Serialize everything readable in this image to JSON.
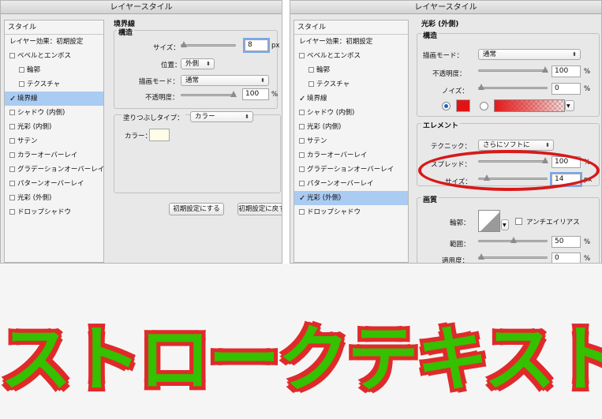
{
  "left_dialog": {
    "title": "レイヤースタイル",
    "sidebar_header": "スタイル",
    "sidebar_items": [
      {
        "label": "レイヤー効果：初期設定",
        "checkbox": false
      },
      {
        "label": "ベベルとエンボス",
        "checkbox": true,
        "checked": false
      },
      {
        "label": "輪郭",
        "checkbox": true,
        "checked": false,
        "sub": true
      },
      {
        "label": "テクスチャ",
        "checkbox": true,
        "checked": false,
        "sub": true
      },
      {
        "label": "境界線",
        "checkbox": true,
        "checked": true,
        "selected": true
      },
      {
        "label": "シャドウ (内側)",
        "checkbox": true,
        "checked": false
      },
      {
        "label": "光彩 (内側)",
        "checkbox": true,
        "checked": false
      },
      {
        "label": "サテン",
        "checkbox": true,
        "checked": false
      },
      {
        "label": "カラーオーバーレイ",
        "checkbox": true,
        "checked": false
      },
      {
        "label": "グラデーションオーバーレイ",
        "checkbox": true,
        "checked": false
      },
      {
        "label": "パターンオーバーレイ",
        "checkbox": true,
        "checked": false
      },
      {
        "label": "光彩 (外側)",
        "checkbox": true,
        "checked": false
      },
      {
        "label": "ドロップシャドウ",
        "checkbox": true,
        "checked": false
      }
    ],
    "section_title": "境界線",
    "group_title": "構造",
    "size_label": "サイズ：",
    "size_value": "8",
    "size_unit": "px",
    "position_label": "位置：",
    "position_value": "外側",
    "blend_label": "描画モード：",
    "blend_value": "通常",
    "opacity_label": "不透明度：",
    "opacity_value": "100",
    "opacity_unit": "%",
    "fill_type_label": "塗りつぶしタイプ：",
    "fill_type_value": "カラー",
    "color_label": "カラー：",
    "color_swatch": "#fffde8",
    "reset_default_button": "初期設定にする",
    "restore_default_button": "初期設定に戻す"
  },
  "right_dialog": {
    "title": "レイヤースタイル",
    "sidebar_header": "スタイル",
    "sidebar_items": [
      {
        "label": "レイヤー効果：初期設定",
        "checkbox": false
      },
      {
        "label": "ベベルとエンボス",
        "checkbox": true,
        "checked": false
      },
      {
        "label": "輪郭",
        "checkbox": true,
        "checked": false,
        "sub": true
      },
      {
        "label": "テクスチャ",
        "checkbox": true,
        "checked": false,
        "sub": true
      },
      {
        "label": "境界線",
        "checkbox": true,
        "checked": true
      },
      {
        "label": "シャドウ (内側)",
        "checkbox": true,
        "checked": false
      },
      {
        "label": "光彩 (内側)",
        "checkbox": true,
        "checked": false
      },
      {
        "label": "サテン",
        "checkbox": true,
        "checked": false
      },
      {
        "label": "カラーオーバーレイ",
        "checkbox": true,
        "checked": false
      },
      {
        "label": "グラデーションオーバーレイ",
        "checkbox": true,
        "checked": false
      },
      {
        "label": "パターンオーバーレイ",
        "checkbox": true,
        "checked": false
      },
      {
        "label": "光彩 (外側)",
        "checkbox": true,
        "checked": true,
        "selected": true
      },
      {
        "label": "ドロップシャドウ",
        "checkbox": true,
        "checked": false
      }
    ],
    "section_title": "光彩 (外側)",
    "structure_title": "構造",
    "blend_label": "描画モード：",
    "blend_value": "通常",
    "opacity_label": "不透明度：",
    "opacity_value": "100",
    "noise_label": "ノイズ：",
    "noise_value": "0",
    "percent_unit": "%",
    "glow_color": "#e01414",
    "elements_title": "エレメント",
    "technique_label": "テクニック：",
    "technique_value": "さらにソフトに",
    "spread_label": "スプレッド：",
    "spread_value": "100",
    "size_label": "サイズ：",
    "size_value": "14",
    "size_unit": "px",
    "quality_title": "画質",
    "contour_label": "輪郭：",
    "antialias_label": "アンチエイリアス",
    "range_label": "範囲：",
    "range_value": "50",
    "jitter_label": "適用度：",
    "jitter_value": "0",
    "annotation_color": "#d81919"
  },
  "headline": {
    "text": "ストロークテキスト",
    "fill_color": "#35c000",
    "stroke_color": "#e02a2a"
  }
}
